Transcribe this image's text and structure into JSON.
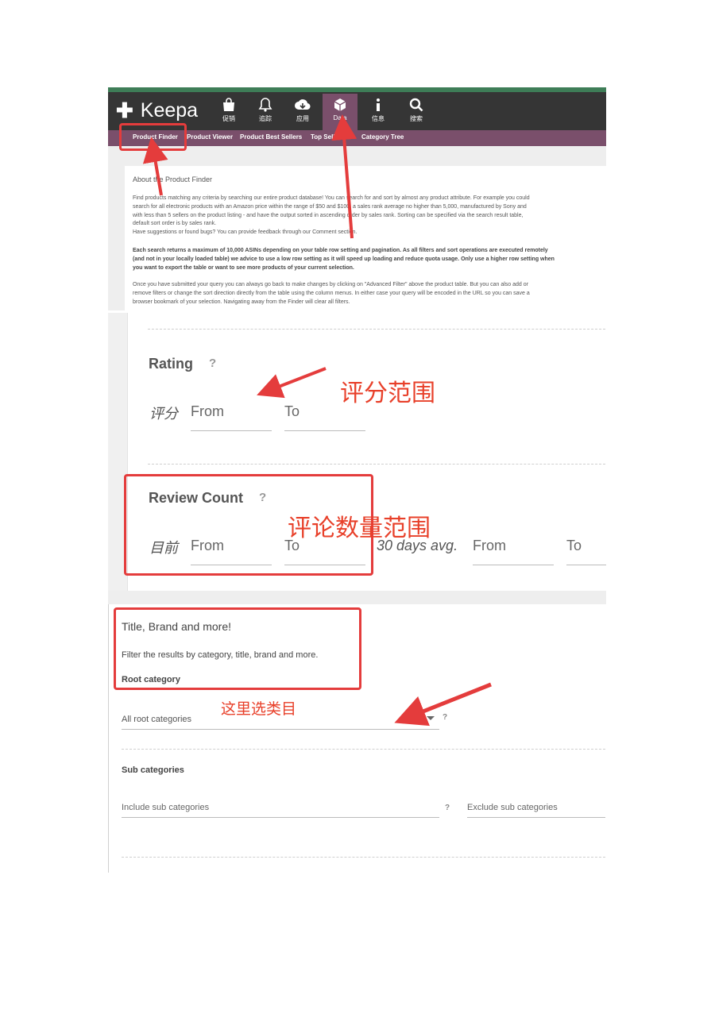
{
  "header": {
    "app_name": "Keepa",
    "nav": [
      {
        "icon": "shopping-bag-icon",
        "label": "促销"
      },
      {
        "icon": "bell-icon",
        "label": "追踪"
      },
      {
        "icon": "cloud-download-icon",
        "label": "应用"
      },
      {
        "icon": "cube-icon",
        "label": "Data"
      },
      {
        "icon": "info-icon",
        "label": "信息"
      },
      {
        "icon": "search-icon",
        "label": "搜索"
      }
    ],
    "sub_nav": [
      "Product Finder",
      "Product Viewer",
      "Product Best Sellers",
      "Top Seller List",
      "Category Tree"
    ]
  },
  "about": {
    "title": "About the Product Finder",
    "p1": [
      "Find products matching any criteria by searching our entire product database! You can search for and sort by almost any product attribute. For example you could",
      "search for all electronic products with an Amazon price within the range of $50 and $100, a sales rank average no higher than 5,000, manufactured by Sony and",
      "with less than 5 sellers on the product listing - and have the output sorted in ascending order by sales rank. Sorting can be specified via the search result table,",
      "default sort order is by sales rank.",
      "Have suggestions or found bugs? You can provide feedback through our Comment section."
    ],
    "p2": [
      "Each search returns a maximum of 10,000 ASINs depending on your table row setting and pagination. As all filters and sort operations are executed remotely",
      "(and not in your locally loaded table) we advice to use a low row setting as it will speed up loading and reduce quota usage. Only use a higher row setting when",
      "you want to export the table or want to see more products of your current selection."
    ],
    "p3": [
      "Once you have submitted your query you can always go back to make changes by clicking on \"Advanced Filter\" above the product table. But you can also add or",
      "remove filters or change the sort direction directly from the table using the column menus. In either case your query will be encoded in the URL so you can save a",
      "browser bookmark of your selection. Navigating away from the Finder will clear all filters."
    ]
  },
  "rating": {
    "title": "Rating",
    "help": "?",
    "row_label": "评分",
    "from_placeholder": "From",
    "to_placeholder": "To"
  },
  "review_count": {
    "title": "Review Count",
    "help": "?",
    "current_label": "目前",
    "avg_label": "30 days avg.",
    "from_placeholder": "From",
    "to_placeholder": "To"
  },
  "title_brand": {
    "heading": "Title, Brand and more!",
    "description": "Filter the results by category, title, brand and more.",
    "root_category_label": "Root category",
    "root_category_value": "All root categories",
    "help": "?",
    "sub_categories_label": "Sub categories",
    "include_placeholder": "Include sub categories",
    "exclude_placeholder": "Exclude sub categories"
  },
  "annotations": {
    "rating_note": "评分范围",
    "review_note": "评论数量范围",
    "category_note": "这里选类目"
  },
  "colors": {
    "header_bg": "#353535",
    "accent_plum": "#7a4f6b",
    "top_stripe": "#3e7d57",
    "annotation_red": "#e43c3c"
  }
}
